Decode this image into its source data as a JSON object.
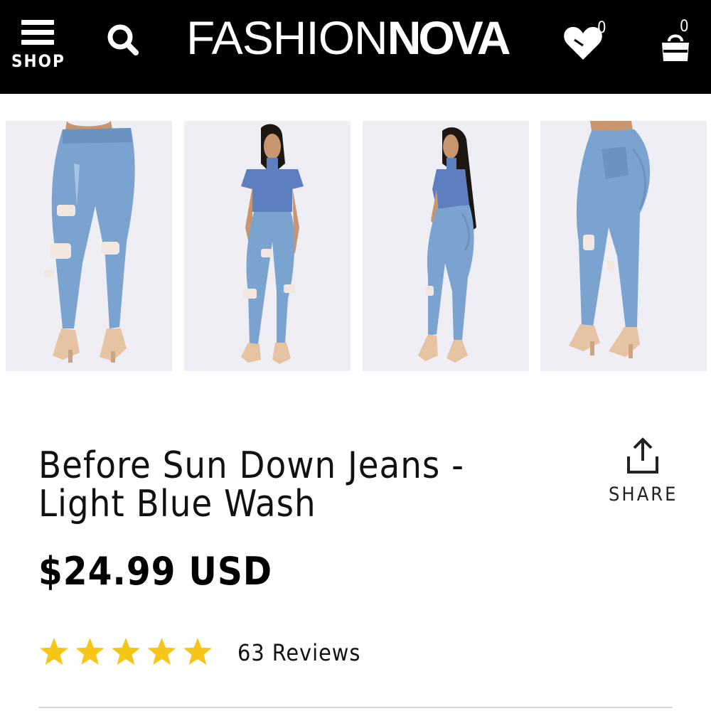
{
  "header": {
    "shop_label": "SHOP",
    "logo_light": "FASHION",
    "logo_bold": "NOVA",
    "wishlist_count": "0",
    "cart_count": "0",
    "colors": {
      "background": "#000000",
      "foreground": "#ffffff"
    }
  },
  "gallery": {
    "images": [
      {
        "view": "front-closeup"
      },
      {
        "view": "front-full"
      },
      {
        "view": "side-full"
      },
      {
        "view": "back-closeup"
      }
    ],
    "colors": {
      "denim": "#7ba3d0",
      "top": "#5d7fc0",
      "background": "#eeeef4"
    }
  },
  "product": {
    "title": "Before Sun Down Jeans - Light Blue Wash",
    "price": "$24.99 USD",
    "rating": 5,
    "rating_max": 5,
    "reviews": "63 Reviews",
    "star_color": "#f5c518"
  },
  "share": {
    "label": "SHARE"
  }
}
